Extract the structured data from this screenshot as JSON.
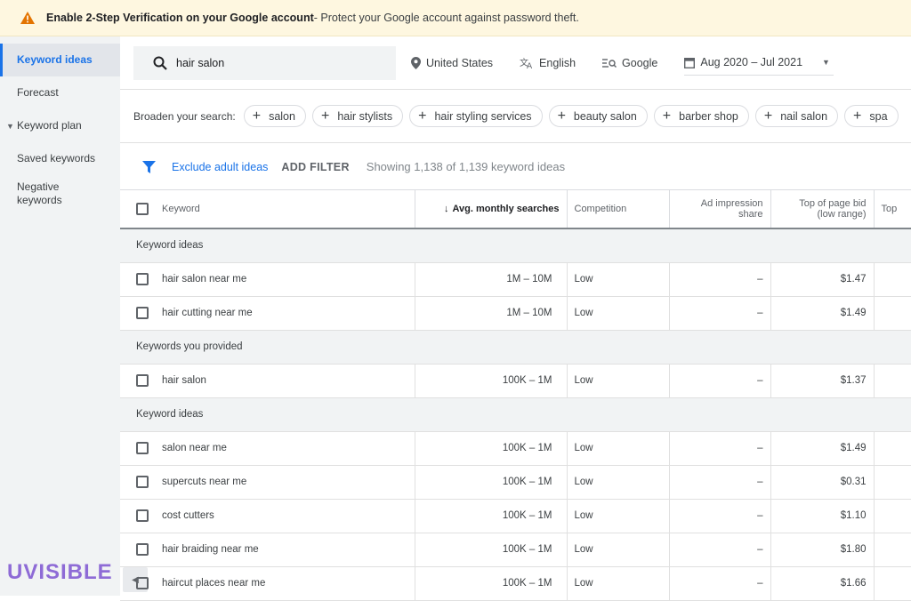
{
  "banner": {
    "title": "Enable 2-Step Verification on your Google account",
    "message": " - Protect your Google account against password theft."
  },
  "sidebar": {
    "items": [
      {
        "label": "Keyword ideas"
      },
      {
        "label": "Forecast"
      },
      {
        "label": "Keyword plan"
      },
      {
        "label": "Saved keywords"
      },
      {
        "label": "Negative keywords"
      }
    ]
  },
  "logo": "UVISIBLE",
  "search": {
    "value": "hair salon"
  },
  "targeting": {
    "location": "United States",
    "language": "English",
    "network": "Google",
    "date_range": "Aug 2020 – Jul 2021"
  },
  "broaden": {
    "label": "Broaden your search:",
    "chips": [
      "salon",
      "hair stylists",
      "hair styling services",
      "beauty salon",
      "barber shop",
      "nail salon",
      "spa"
    ]
  },
  "filters": {
    "exclude_adult": "Exclude adult ideas",
    "add_filter": "ADD FILTER",
    "showing": "Showing 1,138 of 1,139 keyword ideas"
  },
  "table": {
    "headers": {
      "keyword": "Keyword",
      "avg_searches": "Avg. monthly searches",
      "competition": "Competition",
      "ad_impression_line1": "Ad impression",
      "ad_impression_line2": "share",
      "top_bid_low_line1": "Top of page bid",
      "top_bid_low_line2": "(low range)",
      "top_bid_high": "Top"
    },
    "groups": [
      {
        "label": "Keyword ideas"
      },
      {
        "label": "Keywords you provided"
      },
      {
        "label": "Keyword ideas"
      }
    ],
    "rows": [
      {
        "keyword": "hair salon near me",
        "searches": "1M – 10M",
        "competition": "Low",
        "impression": "–",
        "bid": "$1.47"
      },
      {
        "keyword": "hair cutting near me",
        "searches": "1M – 10M",
        "competition": "Low",
        "impression": "–",
        "bid": "$1.49"
      },
      {
        "keyword": "hair salon",
        "searches": "100K – 1M",
        "competition": "Low",
        "impression": "–",
        "bid": "$1.37"
      },
      {
        "keyword": "salon near me",
        "searches": "100K – 1M",
        "competition": "Low",
        "impression": "–",
        "bid": "$1.49"
      },
      {
        "keyword": "supercuts near me",
        "searches": "100K – 1M",
        "competition": "Low",
        "impression": "–",
        "bid": "$0.31"
      },
      {
        "keyword": "cost cutters",
        "searches": "100K – 1M",
        "competition": "Low",
        "impression": "–",
        "bid": "$1.10"
      },
      {
        "keyword": "hair braiding near me",
        "searches": "100K – 1M",
        "competition": "Low",
        "impression": "–",
        "bid": "$1.80"
      },
      {
        "keyword": "haircut places near me",
        "searches": "100K – 1M",
        "competition": "Low",
        "impression": "–",
        "bid": "$1.66"
      }
    ]
  },
  "colors": {
    "accent": "#1a73e8",
    "banner_bg": "#fef7e0",
    "warning": "#e37400",
    "logo": "#8e6bd6"
  }
}
